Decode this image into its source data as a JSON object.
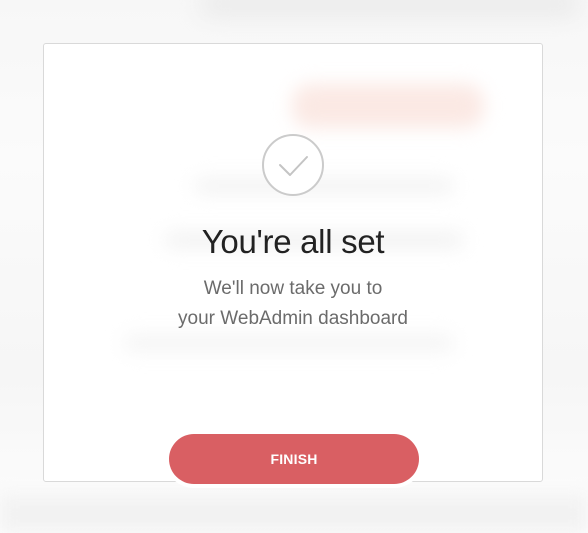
{
  "dialog": {
    "title": "You're all set",
    "message_line1": "We'll now take you to",
    "message_line2": "your WebAdmin dashboard",
    "finish_label": "FINISH"
  },
  "icons": {
    "status": "checkmark-circle-icon"
  },
  "colors": {
    "accent": "#d95f63",
    "title_text": "#222222",
    "message_text": "#6b6b6b",
    "icon_stroke": "#cbcbcb"
  }
}
